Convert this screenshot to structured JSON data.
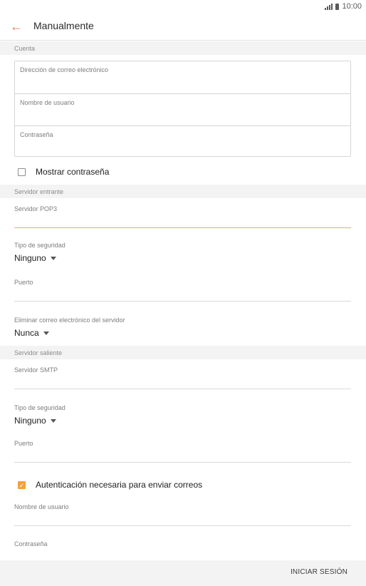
{
  "status_bar": {
    "time": "10:00"
  },
  "header": {
    "title": "Manualmente"
  },
  "account": {
    "section": "Cuenta",
    "email_label": "Dirección de correo electrónico",
    "username_label": "Nombre de usuario",
    "password_label": "Contraseña",
    "show_password": "Mostrar contraseña"
  },
  "incoming": {
    "section": "Servidor entrante",
    "server_label": "Servidor POP3",
    "security_label": "Tipo de seguridad",
    "security_value": "Ninguno",
    "port_label": "Puerto",
    "delete_label": "Eliminar correo electrónico del servidor",
    "delete_value": "Nunca"
  },
  "outgoing": {
    "section": "Servidor saliente",
    "server_label": "Servidor SMTP",
    "security_label": "Tipo de seguridad",
    "security_value": "Ninguno",
    "port_label": "Puerto",
    "auth_label": "Autenticación necesaria para enviar correos",
    "auth_checked": true,
    "username_label": "Nombre de usuario",
    "password_label": "Contraseña"
  },
  "footer": {
    "login_button": "INICIAR SESIÓN"
  },
  "colors": {
    "accent": "#f0764a",
    "checkbox": "#f5a03c",
    "section_bg": "#f3f3f3"
  }
}
